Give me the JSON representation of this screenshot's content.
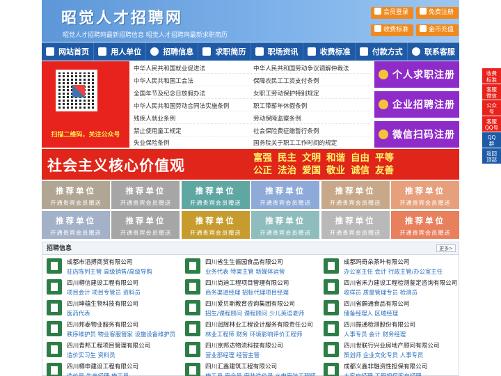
{
  "header": {
    "title": "昭觉人才招聘网",
    "subtitle": "昭觉人才招聘网最新招聘信息   昭觉人才招聘网最新求职简历",
    "buttons": [
      "会员登录",
      "免费注册",
      "收费标准",
      "金币充值"
    ],
    "accent": "#f08a1f"
  },
  "nav": {
    "items": [
      {
        "label": "网站首页",
        "icon": "home-icon"
      },
      {
        "label": "用人单位",
        "icon": "building-icon"
      },
      {
        "label": "招聘信息",
        "icon": "recruit-icon"
      },
      {
        "label": "求职简历",
        "icon": "resume-icon"
      },
      {
        "label": "职场资讯",
        "icon": "news-icon"
      },
      {
        "label": "收费标准",
        "icon": "fee-icon"
      },
      {
        "label": "付款方式",
        "icon": "payment-icon"
      },
      {
        "label": "联系客服",
        "icon": "phone-icon"
      }
    ],
    "color": "#1f5aa6"
  },
  "qr": {
    "caption": "扫描二维码，关注公众号"
  },
  "links": [
    "中华人民共和国就业促进法",
    "中华人民共和国劳动争议调解仲裁法",
    "中华人民共和国工会法",
    "保障农民工工资支付条例",
    "全国年节及纪念日放假办法",
    "女职工劳动保护特别规定",
    "中华人民共和国劳动合同法实施条例",
    "职工带薪年休假条例",
    "残疾人就业条例",
    "劳动保障监察条例",
    "禁止使用童工规定",
    "社会保险费征缴暂行条例",
    "失业保险条例",
    "国务院关于职工工作时间的规定"
  ],
  "register": [
    {
      "label": "个人求职注册",
      "color": "#8e2bc9"
    },
    {
      "label": "企业招聘注册",
      "color": "#8e2bc9"
    },
    {
      "label": "微信扫码注册",
      "color": "#8e2bc9"
    }
  ],
  "banner": {
    "title": "社会主义核心价值观",
    "values_line1": [
      "富强",
      "民主",
      "文明",
      "和谐",
      "自由",
      "平等"
    ],
    "values_line2": [
      "公正",
      "法治",
      "爱国",
      "敬业",
      "诚信",
      "友善"
    ],
    "color": "#e0261a"
  },
  "recommend": {
    "title": "推荐单位",
    "sub": "开通贵宾会员赠送",
    "colors_row1": [
      "#b1a693",
      "#a6a6a6",
      "#5fa7a3",
      "#8eaad8",
      "#c7a98a",
      "#e7a07c"
    ],
    "colors_row2": [
      "#a3b1c9",
      "#a6a6a6",
      "#c79c2e",
      "#8fbdbd",
      "#b9b9b9",
      "#e8805e"
    ]
  },
  "recruit": {
    "title": "招聘信息",
    "more": "更多>",
    "companies": [
      {
        "name": "成都市滔搏商贸有限公司",
        "jobs": "驻店陈列主管 高级销售/高级导购"
      },
      {
        "name": "四川省生生酱园食品有限公司",
        "jobs": "业务代表 特渠主管 新媒体运营"
      },
      {
        "name": "成都玛奇朵茶叶有限公司",
        "jobs": "办公室主任 会计 行政主管/办公室主任"
      },
      {
        "name": "四川樽信建设工程有限公司",
        "jobs": "项目会计 项目专管员 资料员"
      },
      {
        "name": "四川尚迪工程项目管理有限公司",
        "jobs": "商务渠道经理 招标代理项目经理"
      },
      {
        "name": "四川省禾力建设工程检测鉴定咨询有限公司",
        "jobs": "收样员 质量管理专员 检测员"
      },
      {
        "name": "四川坤蕴生物科技有限公司",
        "jobs": "医药代表"
      },
      {
        "name": "四川爱贝斯教育咨询集团有限公司",
        "jobs": "招生/课程顾问 课程顾问 少儿英语老师"
      },
      {
        "name": "四川省願通食品有限公司",
        "jobs": "储备经理人 区域经理"
      },
      {
        "name": "四川邦泰物业服务有限公司",
        "jobs": "秩序维护员 物业客服管家 设施设备维护员"
      },
      {
        "name": "四川润辉林业工程设计服务有限责任公司",
        "jobs": "林业工程师 财务 环境影响评价工程师"
      },
      {
        "name": "四川振通检测股份有限公司",
        "jobs": "人事专员 会计 财务经理"
      },
      {
        "name": "四川青邦工程项目管理有限公司",
        "jobs": "造价实习生 资料员"
      },
      {
        "name": "四川京邦达物流科技有限公司",
        "jobs": "营业部经理 经营主管"
      },
      {
        "name": "四川世联行兴业房地产顾问有限公司",
        "jobs": "策划师 企业文化专员 人事专员"
      },
      {
        "name": "四川樽申建设工程有限公司",
        "jobs": "造价员 生产经理 施工员"
      },
      {
        "name": "四川汇鑫建筑工程有限公司",
        "jobs": "施工员 安全员 安装造价员 水电安装工程师"
      },
      {
        "name": "成都义鑫非融资性担保有限公司",
        "jobs": "大客户经理 工程担保客户经理"
      }
    ]
  },
  "float": [
    {
      "label": "收费\n标准",
      "color": "#e8231d"
    },
    {
      "label": "客服\n微信",
      "color": "#e8231d"
    },
    {
      "label": "公众\n号",
      "color": "#e8231d"
    },
    {
      "label": "客服\nQQ号",
      "color": "#e8231d"
    },
    {
      "label": "QQ\n群",
      "color": "#1f5aa6"
    },
    {
      "label": "返回\n顶部",
      "color": "#1f5aa6"
    }
  ]
}
